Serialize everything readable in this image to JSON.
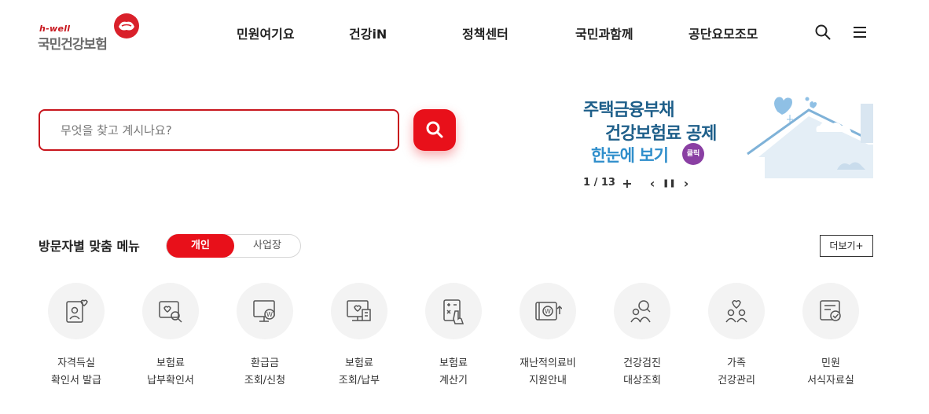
{
  "header": {
    "logo_small": "h-well",
    "logo_main": "국민건강보험",
    "nav": [
      "민원여기요",
      "건강iN",
      "정책센터",
      "국민과함께",
      "공단요모조모"
    ],
    "search_icon": "search-icon",
    "menu_icon": "hamburger-menu-icon"
  },
  "search": {
    "placeholder": "무엇을 찾고 계시나요?",
    "button_icon": "search-icon"
  },
  "banner": {
    "line1": "주택금융부채",
    "line2": "건강보험료 공제",
    "line3": "한눈에 보기",
    "badge": "클릭",
    "counter": "1 / 13",
    "plus": "+",
    "prev": "‹",
    "pause": "❚❚",
    "next": "›"
  },
  "visitor_menu": {
    "title": "방문자별 맞춤 메뉴",
    "tab_personal": "개인",
    "tab_business": "사업장",
    "more": "더보기+",
    "items": [
      {
        "line1": "자격득실",
        "line2": "확인서 발급",
        "icon": "id-card-heart-icon"
      },
      {
        "line1": "보험료",
        "line2": "납부확인서",
        "icon": "card-search-icon"
      },
      {
        "line1": "환급금",
        "line2": "조회/신청",
        "icon": "monitor-won-icon"
      },
      {
        "line1": "보험료",
        "line2": "조회/납부",
        "icon": "screen-receipt-icon"
      },
      {
        "line1": "보험료",
        "line2": "계산기",
        "icon": "calculator-hand-icon"
      },
      {
        "line1": "재난적의료비",
        "line2": "지원안내",
        "icon": "wallet-won-icon"
      },
      {
        "line1": "건강검진",
        "line2": "대상조회",
        "icon": "people-search-icon"
      },
      {
        "line1": "가족",
        "line2": "건강관리",
        "icon": "family-heart-icon"
      },
      {
        "line1": "민원",
        "line2": "서식자료실",
        "icon": "document-check-icon"
      }
    ]
  },
  "colors": {
    "brand_red": "#e8101a",
    "banner_blue": "#1e5f8a",
    "badge_purple": "#8a3fa3"
  }
}
